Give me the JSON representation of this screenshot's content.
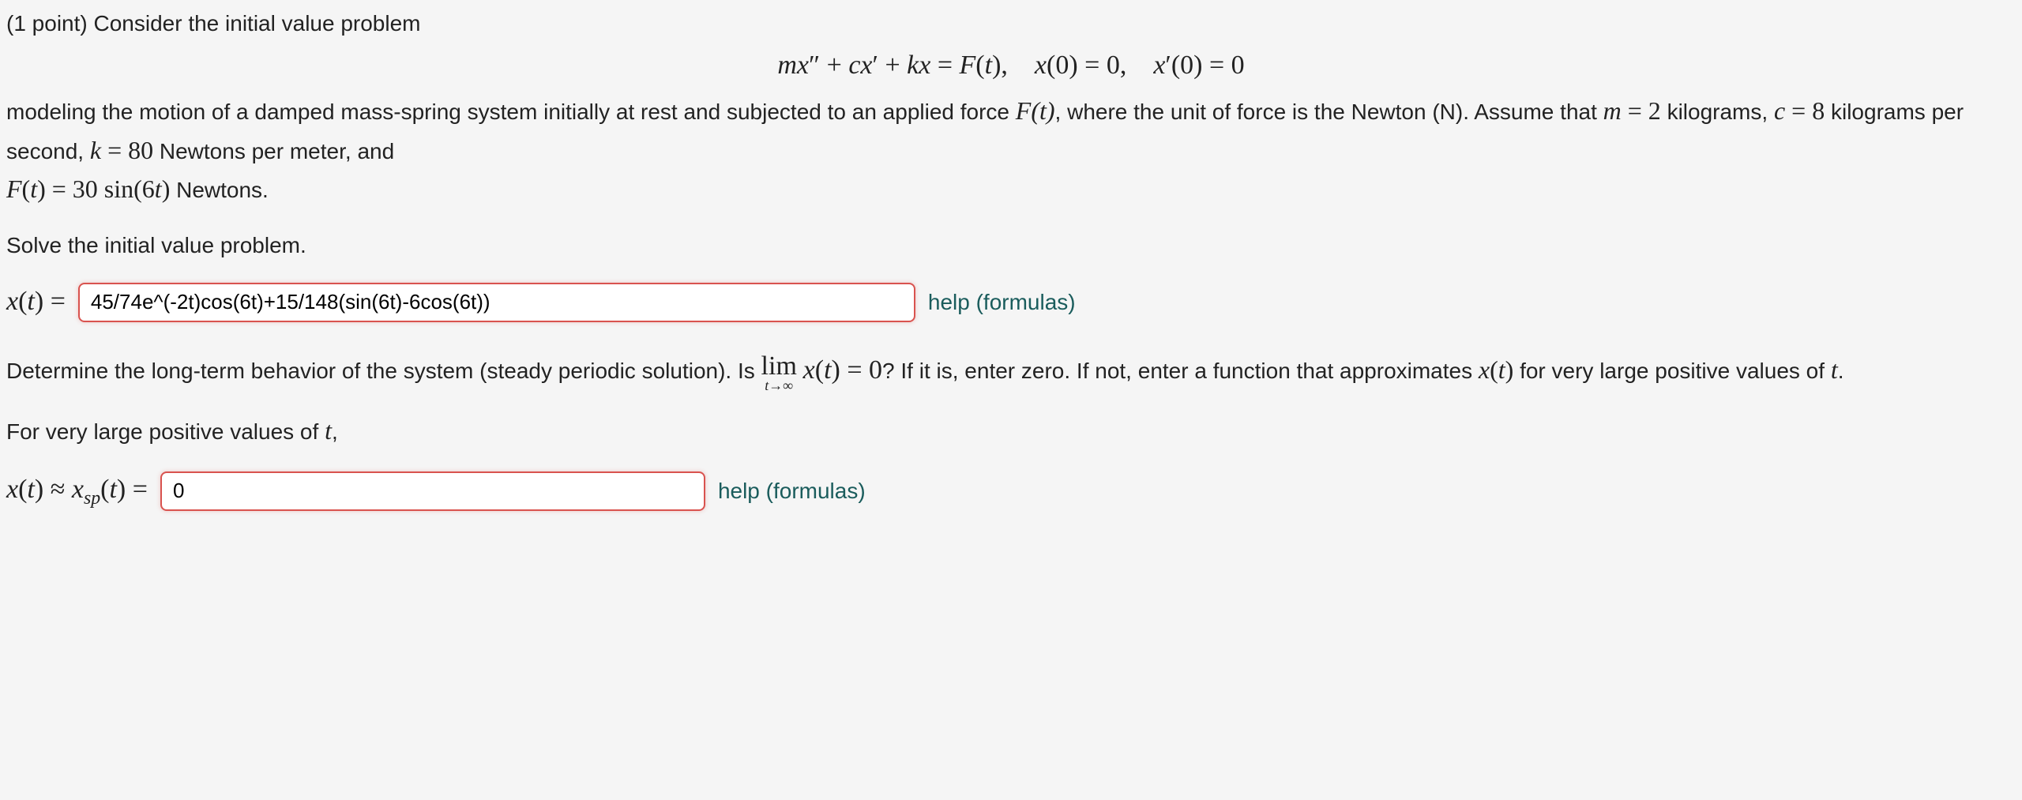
{
  "problem": {
    "points_label": "(1 point) Consider the initial value problem",
    "equation_display": "mx″ + cx′ + kx = F(t), x(0) = 0, x′(0) = 0",
    "description_pre": "modeling the motion of a damped mass-spring system initially at rest and subjected to an applied force ",
    "F_t": "F(t)",
    "description_post": ", where the unit of force is the Newton (N). Assume that ",
    "m_eq": "m = 2",
    "m_unit": " kilograms, ",
    "c_eq": "c = 8",
    "c_unit": " kilograms per second, ",
    "k_eq": "k = 80",
    "k_unit": " Newtons per meter, and",
    "F_eq": "F(t) = 30 sin(6t)",
    "F_unit": " Newtons."
  },
  "part1": {
    "instruction": "Solve the initial value problem.",
    "label": "x(t) =",
    "answer_value": "45/74e^(-2t)cos(6t)+15/148(sin(6t)-6cos(6t))",
    "help_text": "help (formulas)"
  },
  "part2": {
    "description_pre": "Determine the long-term behavior of the system (steady periodic solution). Is ",
    "limit_op": "lim",
    "limit_sub": "t→∞",
    "limit_expr": "x(t) = 0",
    "description_post": "? If it is, enter zero. If not, enter a function that approximates ",
    "xt": "x(t)",
    "description_post2": " for very large positive values of ",
    "t": "t",
    "period": ".",
    "large_t_text_pre": "For very large positive values of ",
    "large_t_text_post": ",",
    "label_xt": "x(t) ≈ x",
    "label_sub": "sp",
    "label_post": "(t) =",
    "answer_value": "0",
    "help_text": "help (formulas)"
  }
}
